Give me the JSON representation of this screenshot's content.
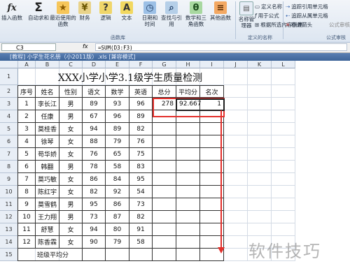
{
  "ribbon": {
    "insert_function": "插入函数",
    "autosum": "自动求和",
    "recent": "最近使用的函数",
    "financial": "财务",
    "logical": "逻辑",
    "text": "文本",
    "datetime": "日期和时间",
    "lookup": "查找与引用",
    "math": "数学和三角函数",
    "other": "其他函数",
    "name_manager": "名称管理器",
    "define_name": "定义名称",
    "use_in_formula": "用于公式",
    "create_from_sel": "根据所选内容创建",
    "trace_precedents": "追踪引用单元格",
    "trace_dependents": "追踪从属单元格",
    "remove_arrows": "移去箭头",
    "show_formulas": "公式审核",
    "group_library": "函数库",
    "group_names": "定义的名称",
    "group_audit": "公式审核",
    "accent": "#f7b640"
  },
  "formula_bar": {
    "name_box": "C3",
    "fx": "fx",
    "formula": "=SUM(D3:F3)"
  },
  "workbook_title": "[教程] 小学生花名册（小2011版）.xls [兼容模式]",
  "columns": [
    "A",
    "B",
    "C",
    "D",
    "E",
    "F",
    "G",
    "H",
    "I",
    "J",
    "K",
    "L"
  ],
  "sheet": {
    "title": "XXX小学小学3.1级学生质量检测",
    "headers": [
      "序号",
      "姓名",
      "性别",
      "语文",
      "数学",
      "英语",
      "总分",
      "平均分",
      "名次"
    ],
    "rows": [
      [
        "1",
        "李长江",
        "男",
        "89",
        "93",
        "96",
        "278",
        "92.667",
        "1"
      ],
      [
        "2",
        "任康",
        "男",
        "67",
        "96",
        "89",
        "",
        "",
        ""
      ],
      [
        "3",
        "莫桂香",
        "女",
        "94",
        "89",
        "82",
        "",
        "",
        ""
      ],
      [
        "4",
        "徐琴",
        "女",
        "88",
        "79",
        "76",
        "",
        "",
        ""
      ],
      [
        "5",
        "苟华娇",
        "女",
        "76",
        "65",
        "75",
        "",
        "",
        ""
      ],
      [
        "6",
        "韩翻",
        "男",
        "78",
        "58",
        "83",
        "",
        "",
        ""
      ],
      [
        "7",
        "莫巧敏",
        "女",
        "86",
        "84",
        "95",
        "",
        "",
        ""
      ],
      [
        "8",
        "陈红宇",
        "女",
        "82",
        "92",
        "54",
        "",
        "",
        ""
      ],
      [
        "9",
        "莫雪鹤",
        "男",
        "95",
        "86",
        "73",
        "",
        "",
        ""
      ],
      [
        "10",
        "王力翔",
        "男",
        "73",
        "87",
        "82",
        "",
        "",
        ""
      ],
      [
        "11",
        "舒慧",
        "女",
        "94",
        "80",
        "91",
        "",
        "",
        ""
      ],
      [
        "12",
        "陈香霖",
        "女",
        "90",
        "79",
        "58",
        "",
        "",
        ""
      ]
    ],
    "footer": "班级平均分"
  },
  "watermark": "软件技巧"
}
